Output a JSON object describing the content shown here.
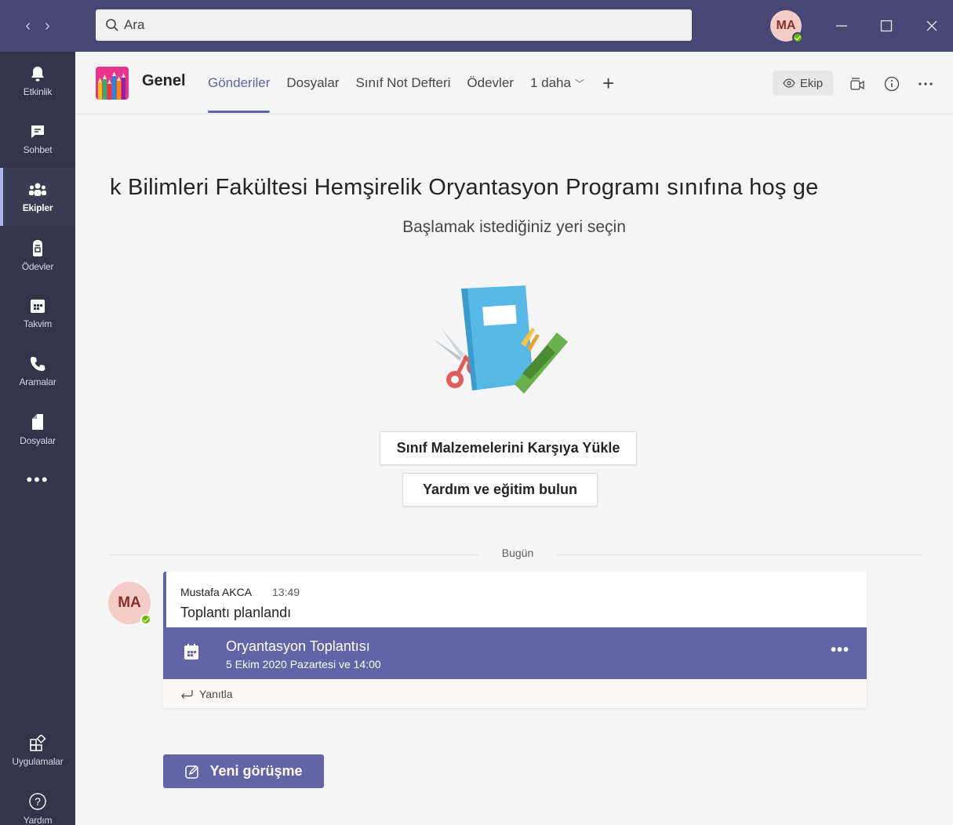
{
  "search": {
    "placeholder": "Ara"
  },
  "user": {
    "initials": "MA"
  },
  "rail": {
    "items": [
      {
        "label": "Etkinlik",
        "icon": "bell-icon"
      },
      {
        "label": "Sohbet",
        "icon": "chat-icon"
      },
      {
        "label": "Ekipler",
        "icon": "teams-icon"
      },
      {
        "label": "Ödevler",
        "icon": "assignments-icon"
      },
      {
        "label": "Takvim",
        "icon": "calendar-icon"
      },
      {
        "label": "Aramalar",
        "icon": "phone-icon"
      },
      {
        "label": "Dosyalar",
        "icon": "files-icon"
      }
    ],
    "more": "•••",
    "bottom": [
      {
        "label": "Uygulamalar",
        "icon": "apps-icon"
      },
      {
        "label": "Yardım",
        "icon": "help-icon"
      }
    ]
  },
  "header": {
    "channel": "Genel",
    "tabs": [
      "Gönderiler",
      "Dosyalar",
      "Sınıf Not Defteri",
      "Ödevler",
      "1 daha"
    ],
    "active_tab": "Gönderiler",
    "team_button": "Ekip"
  },
  "welcome": {
    "title": "k Bilimleri Fakültesi Hemşirelik Oryantasyon Programı sınıfına hoş ge",
    "subtitle": "Başlamak istediğiniz yeri seçin",
    "upload_button": "Sınıf Malzemelerini Karşıya Yükle",
    "help_button": "Yardım ve eğitim bulun"
  },
  "divider": {
    "label": "Bugün"
  },
  "message": {
    "author_initials": "MA",
    "author": "Mustafa AKCA",
    "time": "13:49",
    "text": "Toplantı planlandı",
    "meeting": {
      "title": "Oryantasyon Toplantısı",
      "date": "5 Ekim 2020 Pazartesi ve 14:00"
    },
    "reply": "Yanıtla"
  },
  "new_conversation": "Yeni görüşme",
  "colors": {
    "titlebar": "#464775",
    "rail": "#33344a",
    "accent": "#6264a7",
    "presence": "#6bb700"
  }
}
